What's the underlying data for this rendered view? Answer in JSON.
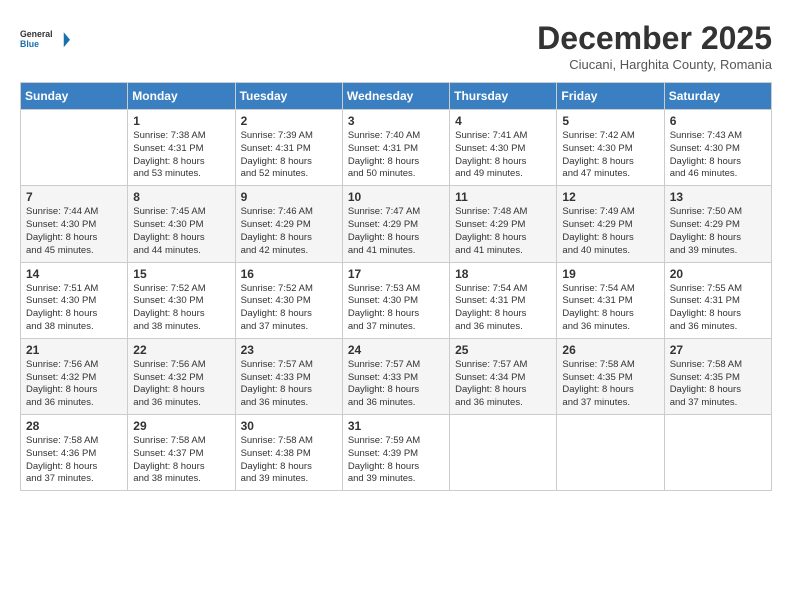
{
  "header": {
    "logo_line1": "General",
    "logo_line2": "Blue",
    "month_title": "December 2025",
    "subtitle": "Ciucani, Harghita County, Romania"
  },
  "weekdays": [
    "Sunday",
    "Monday",
    "Tuesday",
    "Wednesday",
    "Thursday",
    "Friday",
    "Saturday"
  ],
  "weeks": [
    [
      {
        "day": "",
        "info": ""
      },
      {
        "day": "1",
        "info": "Sunrise: 7:38 AM\nSunset: 4:31 PM\nDaylight: 8 hours\nand 53 minutes."
      },
      {
        "day": "2",
        "info": "Sunrise: 7:39 AM\nSunset: 4:31 PM\nDaylight: 8 hours\nand 52 minutes."
      },
      {
        "day": "3",
        "info": "Sunrise: 7:40 AM\nSunset: 4:31 PM\nDaylight: 8 hours\nand 50 minutes."
      },
      {
        "day": "4",
        "info": "Sunrise: 7:41 AM\nSunset: 4:30 PM\nDaylight: 8 hours\nand 49 minutes."
      },
      {
        "day": "5",
        "info": "Sunrise: 7:42 AM\nSunset: 4:30 PM\nDaylight: 8 hours\nand 47 minutes."
      },
      {
        "day": "6",
        "info": "Sunrise: 7:43 AM\nSunset: 4:30 PM\nDaylight: 8 hours\nand 46 minutes."
      }
    ],
    [
      {
        "day": "7",
        "info": "Sunrise: 7:44 AM\nSunset: 4:30 PM\nDaylight: 8 hours\nand 45 minutes."
      },
      {
        "day": "8",
        "info": "Sunrise: 7:45 AM\nSunset: 4:30 PM\nDaylight: 8 hours\nand 44 minutes."
      },
      {
        "day": "9",
        "info": "Sunrise: 7:46 AM\nSunset: 4:29 PM\nDaylight: 8 hours\nand 42 minutes."
      },
      {
        "day": "10",
        "info": "Sunrise: 7:47 AM\nSunset: 4:29 PM\nDaylight: 8 hours\nand 41 minutes."
      },
      {
        "day": "11",
        "info": "Sunrise: 7:48 AM\nSunset: 4:29 PM\nDaylight: 8 hours\nand 41 minutes."
      },
      {
        "day": "12",
        "info": "Sunrise: 7:49 AM\nSunset: 4:29 PM\nDaylight: 8 hours\nand 40 minutes."
      },
      {
        "day": "13",
        "info": "Sunrise: 7:50 AM\nSunset: 4:29 PM\nDaylight: 8 hours\nand 39 minutes."
      }
    ],
    [
      {
        "day": "14",
        "info": "Sunrise: 7:51 AM\nSunset: 4:30 PM\nDaylight: 8 hours\nand 38 minutes."
      },
      {
        "day": "15",
        "info": "Sunrise: 7:52 AM\nSunset: 4:30 PM\nDaylight: 8 hours\nand 38 minutes."
      },
      {
        "day": "16",
        "info": "Sunrise: 7:52 AM\nSunset: 4:30 PM\nDaylight: 8 hours\nand 37 minutes."
      },
      {
        "day": "17",
        "info": "Sunrise: 7:53 AM\nSunset: 4:30 PM\nDaylight: 8 hours\nand 37 minutes."
      },
      {
        "day": "18",
        "info": "Sunrise: 7:54 AM\nSunset: 4:31 PM\nDaylight: 8 hours\nand 36 minutes."
      },
      {
        "day": "19",
        "info": "Sunrise: 7:54 AM\nSunset: 4:31 PM\nDaylight: 8 hours\nand 36 minutes."
      },
      {
        "day": "20",
        "info": "Sunrise: 7:55 AM\nSunset: 4:31 PM\nDaylight: 8 hours\nand 36 minutes."
      }
    ],
    [
      {
        "day": "21",
        "info": "Sunrise: 7:56 AM\nSunset: 4:32 PM\nDaylight: 8 hours\nand 36 minutes."
      },
      {
        "day": "22",
        "info": "Sunrise: 7:56 AM\nSunset: 4:32 PM\nDaylight: 8 hours\nand 36 minutes."
      },
      {
        "day": "23",
        "info": "Sunrise: 7:57 AM\nSunset: 4:33 PM\nDaylight: 8 hours\nand 36 minutes."
      },
      {
        "day": "24",
        "info": "Sunrise: 7:57 AM\nSunset: 4:33 PM\nDaylight: 8 hours\nand 36 minutes."
      },
      {
        "day": "25",
        "info": "Sunrise: 7:57 AM\nSunset: 4:34 PM\nDaylight: 8 hours\nand 36 minutes."
      },
      {
        "day": "26",
        "info": "Sunrise: 7:58 AM\nSunset: 4:35 PM\nDaylight: 8 hours\nand 37 minutes."
      },
      {
        "day": "27",
        "info": "Sunrise: 7:58 AM\nSunset: 4:35 PM\nDaylight: 8 hours\nand 37 minutes."
      }
    ],
    [
      {
        "day": "28",
        "info": "Sunrise: 7:58 AM\nSunset: 4:36 PM\nDaylight: 8 hours\nand 37 minutes."
      },
      {
        "day": "29",
        "info": "Sunrise: 7:58 AM\nSunset: 4:37 PM\nDaylight: 8 hours\nand 38 minutes."
      },
      {
        "day": "30",
        "info": "Sunrise: 7:58 AM\nSunset: 4:38 PM\nDaylight: 8 hours\nand 39 minutes."
      },
      {
        "day": "31",
        "info": "Sunrise: 7:59 AM\nSunset: 4:39 PM\nDaylight: 8 hours\nand 39 minutes."
      },
      {
        "day": "",
        "info": ""
      },
      {
        "day": "",
        "info": ""
      },
      {
        "day": "",
        "info": ""
      }
    ]
  ]
}
